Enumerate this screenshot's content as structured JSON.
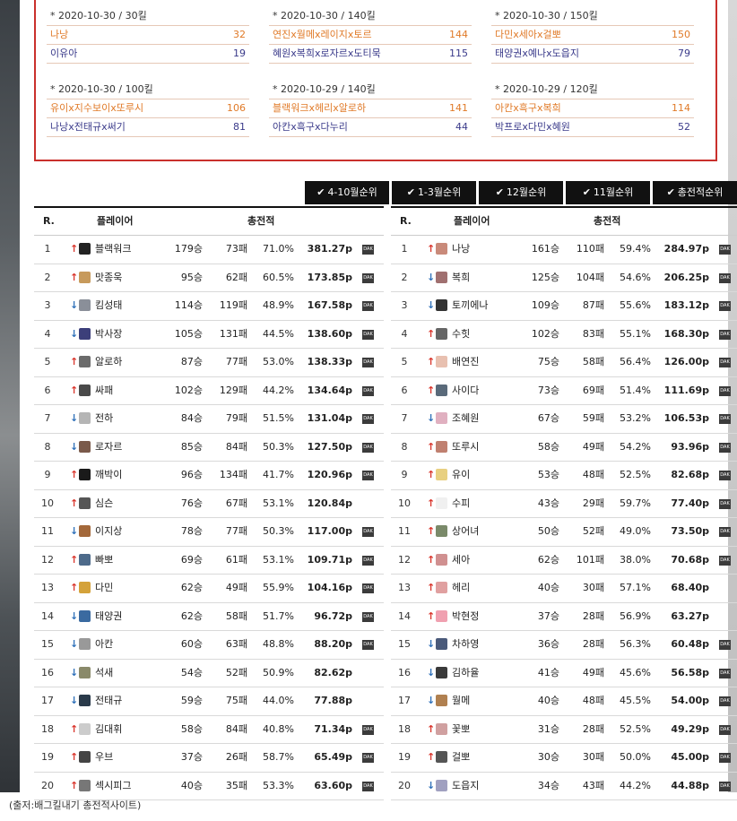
{
  "duos": [
    {
      "head": "* 2020-10-30 / 30킬",
      "rows": [
        {
          "names": "나낭",
          "val": "32"
        },
        {
          "names": "이유아",
          "val": "19"
        }
      ]
    },
    {
      "head": "* 2020-10-30 / 140킬",
      "rows": [
        {
          "names": "연진x월메x레이지x토르",
          "val": "144"
        },
        {
          "names": "혜원x복희x로자르x도티묵",
          "val": "115"
        }
      ]
    },
    {
      "head": "* 2020-10-30 / 150킬",
      "rows": [
        {
          "names": "다민x세아x걸뽀",
          "val": "150"
        },
        {
          "names": "태양권x예나x도읍지",
          "val": "79"
        }
      ]
    },
    {
      "head": "* 2020-10-30 / 100킬",
      "rows": [
        {
          "names": "유이x지수보이x또루시",
          "val": "106"
        },
        {
          "names": "나낭x전태규x써기",
          "val": "81"
        }
      ]
    },
    {
      "head": "* 2020-10-29 / 140킬",
      "rows": [
        {
          "names": "블랙워크x헤리x알로하",
          "val": "141"
        },
        {
          "names": "아칸x흑구x다누리",
          "val": "44"
        }
      ]
    },
    {
      "head": "* 2020-10-29 / 120킬",
      "rows": [
        {
          "names": "아칸x흑구x복희",
          "val": "114"
        },
        {
          "names": "박프로x다민x혜원",
          "val": "52"
        }
      ]
    }
  ],
  "tabs": [
    "4-10월순위",
    "1-3월순위",
    "12월순위",
    "11월순위",
    "총전적순위"
  ],
  "table_headers": {
    "rank": "R.",
    "player": "플레이어",
    "record": "총전적"
  },
  "dak_label": "DAK",
  "colors": {
    "up": "#d9342b",
    "down": "#2d6fb8",
    "box_border": "#c9302c",
    "duo_orange": "#e07a28",
    "duo_navy": "#3a3a8a"
  },
  "left_table": [
    {
      "r": "1",
      "dir": "up",
      "name": "블랙워크",
      "w": "179승",
      "l": "73패",
      "rate": "71.0%",
      "pts": "381.27p",
      "dak": true,
      "av": "#222"
    },
    {
      "r": "2",
      "dir": "up",
      "name": "맛종욱",
      "w": "95승",
      "l": "62패",
      "rate": "60.5%",
      "pts": "173.85p",
      "dak": true,
      "av": "#c79a5c"
    },
    {
      "r": "3",
      "dir": "down",
      "name": "킴성태",
      "w": "114승",
      "l": "119패",
      "rate": "48.9%",
      "pts": "167.58p",
      "dak": true,
      "av": "#8a8f99"
    },
    {
      "r": "4",
      "dir": "down",
      "name": "박사장",
      "w": "105승",
      "l": "131패",
      "rate": "44.5%",
      "pts": "138.60p",
      "dak": true,
      "av": "#3c3f7a"
    },
    {
      "r": "5",
      "dir": "up",
      "name": "알로하",
      "w": "87승",
      "l": "77패",
      "rate": "53.0%",
      "pts": "138.33p",
      "dak": true,
      "av": "#6b6b6b"
    },
    {
      "r": "6",
      "dir": "up",
      "name": "싸패",
      "w": "102승",
      "l": "129패",
      "rate": "44.2%",
      "pts": "134.64p",
      "dak": true,
      "av": "#4a4a4a"
    },
    {
      "r": "7",
      "dir": "down",
      "name": "전하",
      "w": "84승",
      "l": "79패",
      "rate": "51.5%",
      "pts": "131.04p",
      "dak": true,
      "av": "#b5b5b5"
    },
    {
      "r": "8",
      "dir": "down",
      "name": "로자르",
      "w": "85승",
      "l": "84패",
      "rate": "50.3%",
      "pts": "127.50p",
      "dak": true,
      "av": "#7a5a4a"
    },
    {
      "r": "9",
      "dir": "up",
      "name": "깨박이",
      "w": "96승",
      "l": "134패",
      "rate": "41.7%",
      "pts": "120.96p",
      "dak": true,
      "av": "#1a1a1a"
    },
    {
      "r": "10",
      "dir": "up",
      "name": "심슨",
      "w": "76승",
      "l": "67패",
      "rate": "53.1%",
      "pts": "120.84p",
      "dak": false,
      "av": "#555"
    },
    {
      "r": "11",
      "dir": "down",
      "name": "이지상",
      "w": "78승",
      "l": "77패",
      "rate": "50.3%",
      "pts": "117.00p",
      "dak": true,
      "av": "#a3683a"
    },
    {
      "r": "12",
      "dir": "up",
      "name": "빠뽀",
      "w": "69승",
      "l": "61패",
      "rate": "53.1%",
      "pts": "109.71p",
      "dak": true,
      "av": "#4d6a8a"
    },
    {
      "r": "13",
      "dir": "up",
      "name": "다민",
      "w": "62승",
      "l": "49패",
      "rate": "55.9%",
      "pts": "104.16p",
      "dak": true,
      "av": "#d4a23a"
    },
    {
      "r": "14",
      "dir": "down",
      "name": "태양권",
      "w": "62승",
      "l": "58패",
      "rate": "51.7%",
      "pts": "96.72p",
      "dak": true,
      "av": "#3a6aa0"
    },
    {
      "r": "15",
      "dir": "down",
      "name": "아칸",
      "w": "60승",
      "l": "63패",
      "rate": "48.8%",
      "pts": "88.20p",
      "dak": true,
      "av": "#999"
    },
    {
      "r": "16",
      "dir": "down",
      "name": "석새",
      "w": "54승",
      "l": "52패",
      "rate": "50.9%",
      "pts": "82.62p",
      "dak": false,
      "av": "#8a8a6a"
    },
    {
      "r": "17",
      "dir": "down",
      "name": "전태규",
      "w": "59승",
      "l": "75패",
      "rate": "44.0%",
      "pts": "77.88p",
      "dak": false,
      "av": "#2a3a4a"
    },
    {
      "r": "18",
      "dir": "up",
      "name": "김대휘",
      "w": "58승",
      "l": "84패",
      "rate": "40.8%",
      "pts": "71.34p",
      "dak": true,
      "av": "#ccc"
    },
    {
      "r": "19",
      "dir": "up",
      "name": "우브",
      "w": "37승",
      "l": "26패",
      "rate": "58.7%",
      "pts": "65.49p",
      "dak": true,
      "av": "#444"
    },
    {
      "r": "20",
      "dir": "up",
      "name": "섹시피그",
      "w": "40승",
      "l": "35패",
      "rate": "53.3%",
      "pts": "63.60p",
      "dak": true,
      "av": "#777"
    }
  ],
  "right_table": [
    {
      "r": "1",
      "dir": "up",
      "name": "나낭",
      "w": "161승",
      "l": "110패",
      "rate": "59.4%",
      "pts": "284.97p",
      "dak": true,
      "av": "#c98a7a"
    },
    {
      "r": "2",
      "dir": "down",
      "name": "복희",
      "w": "125승",
      "l": "104패",
      "rate": "54.6%",
      "pts": "206.25p",
      "dak": true,
      "av": "#a07070"
    },
    {
      "r": "3",
      "dir": "down",
      "name": "토끼에나",
      "w": "109승",
      "l": "87패",
      "rate": "55.6%",
      "pts": "183.12p",
      "dak": true,
      "av": "#333"
    },
    {
      "r": "4",
      "dir": "up",
      "name": "수힛",
      "w": "102승",
      "l": "83패",
      "rate": "55.1%",
      "pts": "168.30p",
      "dak": true,
      "av": "#666"
    },
    {
      "r": "5",
      "dir": "up",
      "name": "배연진",
      "w": "75승",
      "l": "58패",
      "rate": "56.4%",
      "pts": "126.00p",
      "dak": true,
      "av": "#e8c0b0"
    },
    {
      "r": "6",
      "dir": "up",
      "name": "사이다",
      "w": "73승",
      "l": "69패",
      "rate": "51.4%",
      "pts": "111.69p",
      "dak": true,
      "av": "#5a6a7a"
    },
    {
      "r": "7",
      "dir": "down",
      "name": "조혜원",
      "w": "67승",
      "l": "59패",
      "rate": "53.2%",
      "pts": "106.53p",
      "dak": true,
      "av": "#e0b0c0"
    },
    {
      "r": "8",
      "dir": "up",
      "name": "또루시",
      "w": "58승",
      "l": "49패",
      "rate": "54.2%",
      "pts": "93.96p",
      "dak": true,
      "av": "#c08070"
    },
    {
      "r": "9",
      "dir": "up",
      "name": "유이",
      "w": "53승",
      "l": "48패",
      "rate": "52.5%",
      "pts": "82.68p",
      "dak": true,
      "av": "#e8d080"
    },
    {
      "r": "10",
      "dir": "up",
      "name": "수피",
      "w": "43승",
      "l": "29패",
      "rate": "59.7%",
      "pts": "77.40p",
      "dak": true,
      "av": "#f0f0f0"
    },
    {
      "r": "11",
      "dir": "up",
      "name": "상어녀",
      "w": "50승",
      "l": "52패",
      "rate": "49.0%",
      "pts": "73.50p",
      "dak": true,
      "av": "#7a8a6a"
    },
    {
      "r": "12",
      "dir": "up",
      "name": "세아",
      "w": "62승",
      "l": "101패",
      "rate": "38.0%",
      "pts": "70.68p",
      "dak": true,
      "av": "#d09090"
    },
    {
      "r": "13",
      "dir": "up",
      "name": "헤리",
      "w": "40승",
      "l": "30패",
      "rate": "57.1%",
      "pts": "68.40p",
      "dak": false,
      "av": "#e0a0a0"
    },
    {
      "r": "14",
      "dir": "up",
      "name": "박현정",
      "w": "37승",
      "l": "28패",
      "rate": "56.9%",
      "pts": "63.27p",
      "dak": false,
      "av": "#f0a0b0"
    },
    {
      "r": "15",
      "dir": "down",
      "name": "차하영",
      "w": "36승",
      "l": "28패",
      "rate": "56.3%",
      "pts": "60.48p",
      "dak": true,
      "av": "#4a5a7a"
    },
    {
      "r": "16",
      "dir": "down",
      "name": "김하율",
      "w": "41승",
      "l": "49패",
      "rate": "45.6%",
      "pts": "56.58p",
      "dak": true,
      "av": "#3a3a3a"
    },
    {
      "r": "17",
      "dir": "down",
      "name": "월메",
      "w": "40승",
      "l": "48패",
      "rate": "45.5%",
      "pts": "54.00p",
      "dak": true,
      "av": "#b08050"
    },
    {
      "r": "18",
      "dir": "up",
      "name": "꽃뽀",
      "w": "31승",
      "l": "28패",
      "rate": "52.5%",
      "pts": "49.29p",
      "dak": true,
      "av": "#d0a0a0"
    },
    {
      "r": "19",
      "dir": "up",
      "name": "걸뽀",
      "w": "30승",
      "l": "30패",
      "rate": "50.0%",
      "pts": "45.00p",
      "dak": true,
      "av": "#555"
    },
    {
      "r": "20",
      "dir": "down",
      "name": "도읍지",
      "w": "34승",
      "l": "43패",
      "rate": "44.2%",
      "pts": "44.88p",
      "dak": true,
      "av": "#a0a0c0"
    }
  ],
  "caption": "(출저:배그킬내기 총전적사이트)"
}
